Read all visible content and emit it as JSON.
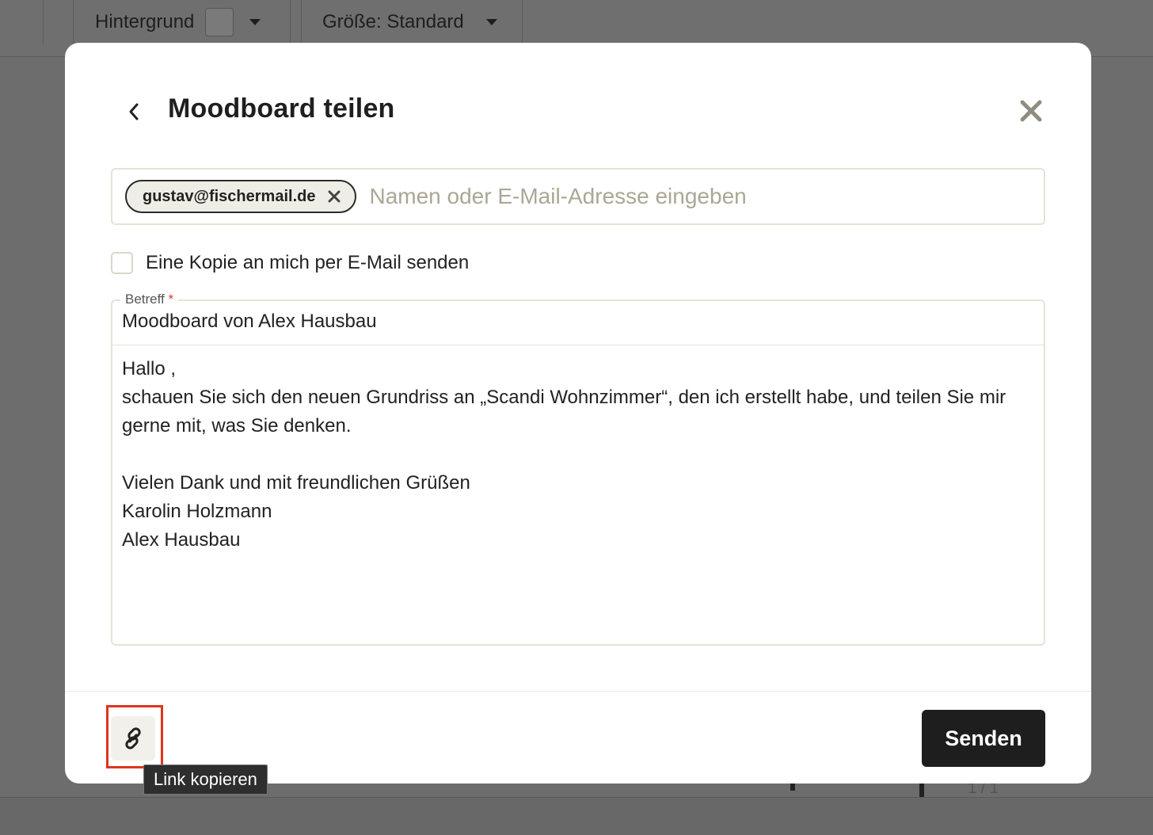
{
  "toolbar": {
    "background_label": "Hintergrund",
    "size_label": "Größe: Standard"
  },
  "status": {
    "page_indicator": "1 / 1"
  },
  "dialog": {
    "title": "Moodboard teilen",
    "recipients": {
      "chips": [
        "gustav@fischermail.de"
      ],
      "placeholder": "Namen oder E-Mail-Adresse eingeben"
    },
    "copy_checkbox": {
      "label": "Eine Kopie an mich per E-Mail senden",
      "checked": false
    },
    "subject": {
      "label": "Betreff",
      "required_mark": "*",
      "value": "Moodboard von Alex Hausbau"
    },
    "message": "Hallo ,\nschauen Sie sich den neuen Grundriss an „Scandi Wohnzimmer“, den ich erstellt habe, und teilen Sie mir gerne mit, was Sie denken.\n\nVielen Dank und mit freundlichen Grüßen\nKarolin Holzmann\nAlex Hausbau",
    "link_tooltip": "Link kopieren",
    "send_label": "Senden"
  },
  "icons": {
    "back": "chevron-left-icon",
    "close": "close-icon",
    "chip_remove": "x-icon",
    "copy_link": "link-icon"
  },
  "colors": {
    "overlay": "#6d6d6d",
    "primary_button": "#1e1e1e",
    "chip_background": "#efeee6",
    "highlight": "#e0341c"
  }
}
